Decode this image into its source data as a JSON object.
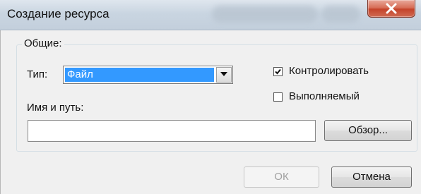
{
  "window": {
    "title": "Создание ресурса"
  },
  "group": {
    "legend": "Общие:",
    "type_label": "Тип:",
    "type_value": "Файл",
    "path_label": "Имя и путь:",
    "path_value": "",
    "monitor_checkbox": {
      "label": "Контролировать",
      "checked": true
    },
    "executable_checkbox": {
      "label": "Выполняемый",
      "checked": false
    }
  },
  "buttons": {
    "browse": "Обзор...",
    "ok": "ОК",
    "cancel": "Отмена"
  }
}
